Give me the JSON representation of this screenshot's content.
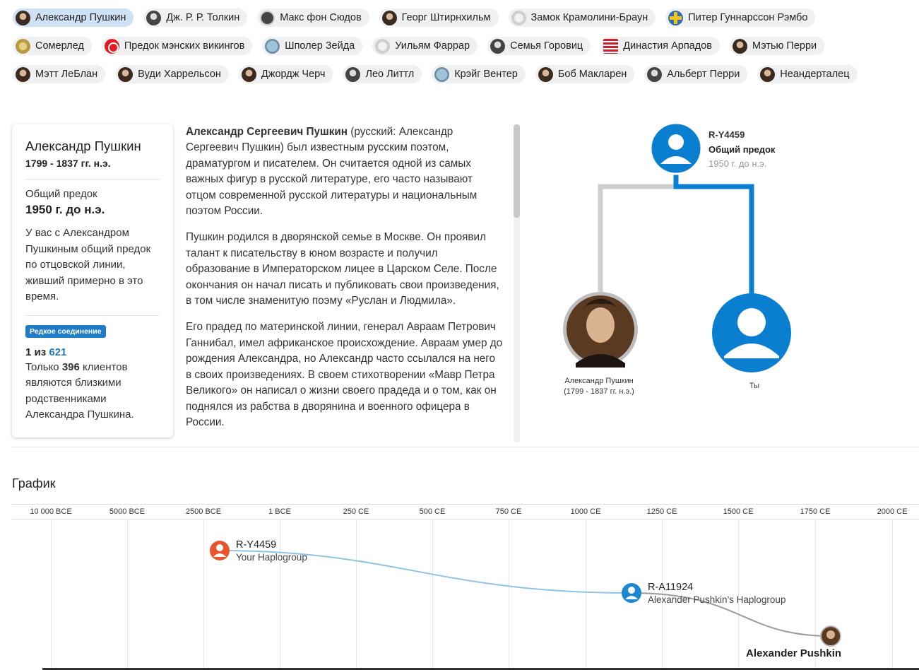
{
  "chips": [
    [
      {
        "label": "Александр Пушкин",
        "icon": "pushkin-portrait-icon",
        "active": true
      },
      {
        "label": "Дж. Р. Р. Толкин",
        "icon": "tolkien-portrait-icon"
      },
      {
        "label": "Макс фон Сюдов",
        "icon": "von-sydow-portrait-icon"
      },
      {
        "label": "Георг Штирнхильм",
        "icon": "stiernhielm-portrait-icon"
      },
      {
        "label": "Замок Крамолини-Браун",
        "icon": "castle-icon"
      },
      {
        "label": "Питер Гуннарссон Рэмбо",
        "icon": "swedish-flag-icon"
      }
    ],
    [
      {
        "label": "Сомерлед",
        "icon": "coin-icon"
      },
      {
        "label": "Предок мэнских викингов",
        "icon": "isle-of-man-flag-icon"
      },
      {
        "label": "Шполер Зейда",
        "icon": "artwork-icon"
      },
      {
        "label": "Уильям Фаррар",
        "icon": "farrar-portrait-icon"
      },
      {
        "label": "Семья Горовиц",
        "icon": "horowitz-portrait-icon"
      },
      {
        "label": "Династия Арпадов",
        "icon": "arpad-flag-icon"
      },
      {
        "label": "Мэтью Перри",
        "icon": "perry-portrait-icon"
      }
    ],
    [
      {
        "label": "Мэтт ЛеБлан",
        "icon": "leblanc-portrait-icon"
      },
      {
        "label": "Вуди Харрельсон",
        "icon": "harrelson-portrait-icon"
      },
      {
        "label": "Джордж Черч",
        "icon": "church-portrait-icon"
      },
      {
        "label": "Лео Литтл",
        "icon": "little-portrait-icon"
      },
      {
        "label": "Крэйг Вентер",
        "icon": "venter-portrait-icon"
      },
      {
        "label": "Боб Макларен",
        "icon": "mclaren-portrait-icon"
      },
      {
        "label": "Альберт Перри",
        "icon": "albert-perry-portrait-icon"
      },
      {
        "label": "Неандерталец",
        "icon": "neanderthal-icon"
      }
    ]
  ],
  "card": {
    "name": "Александр Пушкин",
    "dates": "1799 - 1837 гг. н.э.",
    "common_ancestor_label": "Общий предок",
    "common_ancestor_date": "1950 г. до н.э.",
    "description": "У вас с Александром Пушкиным общий предок по отцовской линии, живший примерно в это время.",
    "badge": "Редкое соединение",
    "count_prefix": "1 из",
    "count_total": "621",
    "rarity_pre": "Только",
    "rarity_num": "396",
    "rarity_post": "клиентов являются близкими родственниками Александра Пушкина."
  },
  "bio": {
    "p1_bold": "Александр Сергеевич Пушкин",
    "p1_rest": " (русский: Александр Сергеевич Пушкин) был известным русским поэтом, драматургом и писателем. Он считается одной из самых важных фигур в русской литературе, его часто называют отцом современной русской литературы и национальным поэтом России.",
    "p2": "Пушкин родился в дворянской семье в Москве. Он проявил талант к писательству в юном возрасте и получил образование в Императорском лицее в Царском Селе. После окончания он начал писать и публиковать свои произведения, в том числе знаменитую поэму «Руслан и Людмила».",
    "p3": "Его прадед по материнской линии, генерал Авраам Петрович Ганнибал, имел африканское происхождение. Авраам умер до рождения Александра, но Александр часто ссылался на него в своих произведениях. В своем стихотворении «Мавр Петра Великого» он написал о жизни своего прадеда и о том, как он поднялся из рабства в дворянина и военного офицера в России."
  },
  "tree": {
    "haplogroup": "R-Y4459",
    "common_ancestor_label": "Общий предок",
    "common_ancestor_year": "1950 г. до н.э.",
    "person_caption": "Александр Пушкин\n(1799 - 1837 гг. н.э.)",
    "you_caption": "Ты",
    "colors": {
      "you_line": "#0a7fcf",
      "other_line": "#cfcfcf"
    }
  },
  "timeline": {
    "title": "График",
    "ticks": [
      "10 000 BCE",
      "5000 BCE",
      "2500 BCE",
      "1 BCE",
      "250 CE",
      "500 CE",
      "750 CE",
      "1000 CE",
      "1250 CE",
      "1500 CE",
      "1750 CE",
      "2000 CE"
    ],
    "nodes": [
      {
        "name": "R-Y4459",
        "sub": "Your Haplogroup",
        "color": "#e8552b"
      },
      {
        "name": "R-A11924",
        "sub": "Alexander Pushkin's Haplogroup",
        "color": "#1c87d2"
      },
      {
        "name": "Alexander Pushkin",
        "sub": ""
      }
    ],
    "colors": {
      "your_curve": "#8fc4e3",
      "pushkin_curve": "#9b9b9b"
    }
  }
}
